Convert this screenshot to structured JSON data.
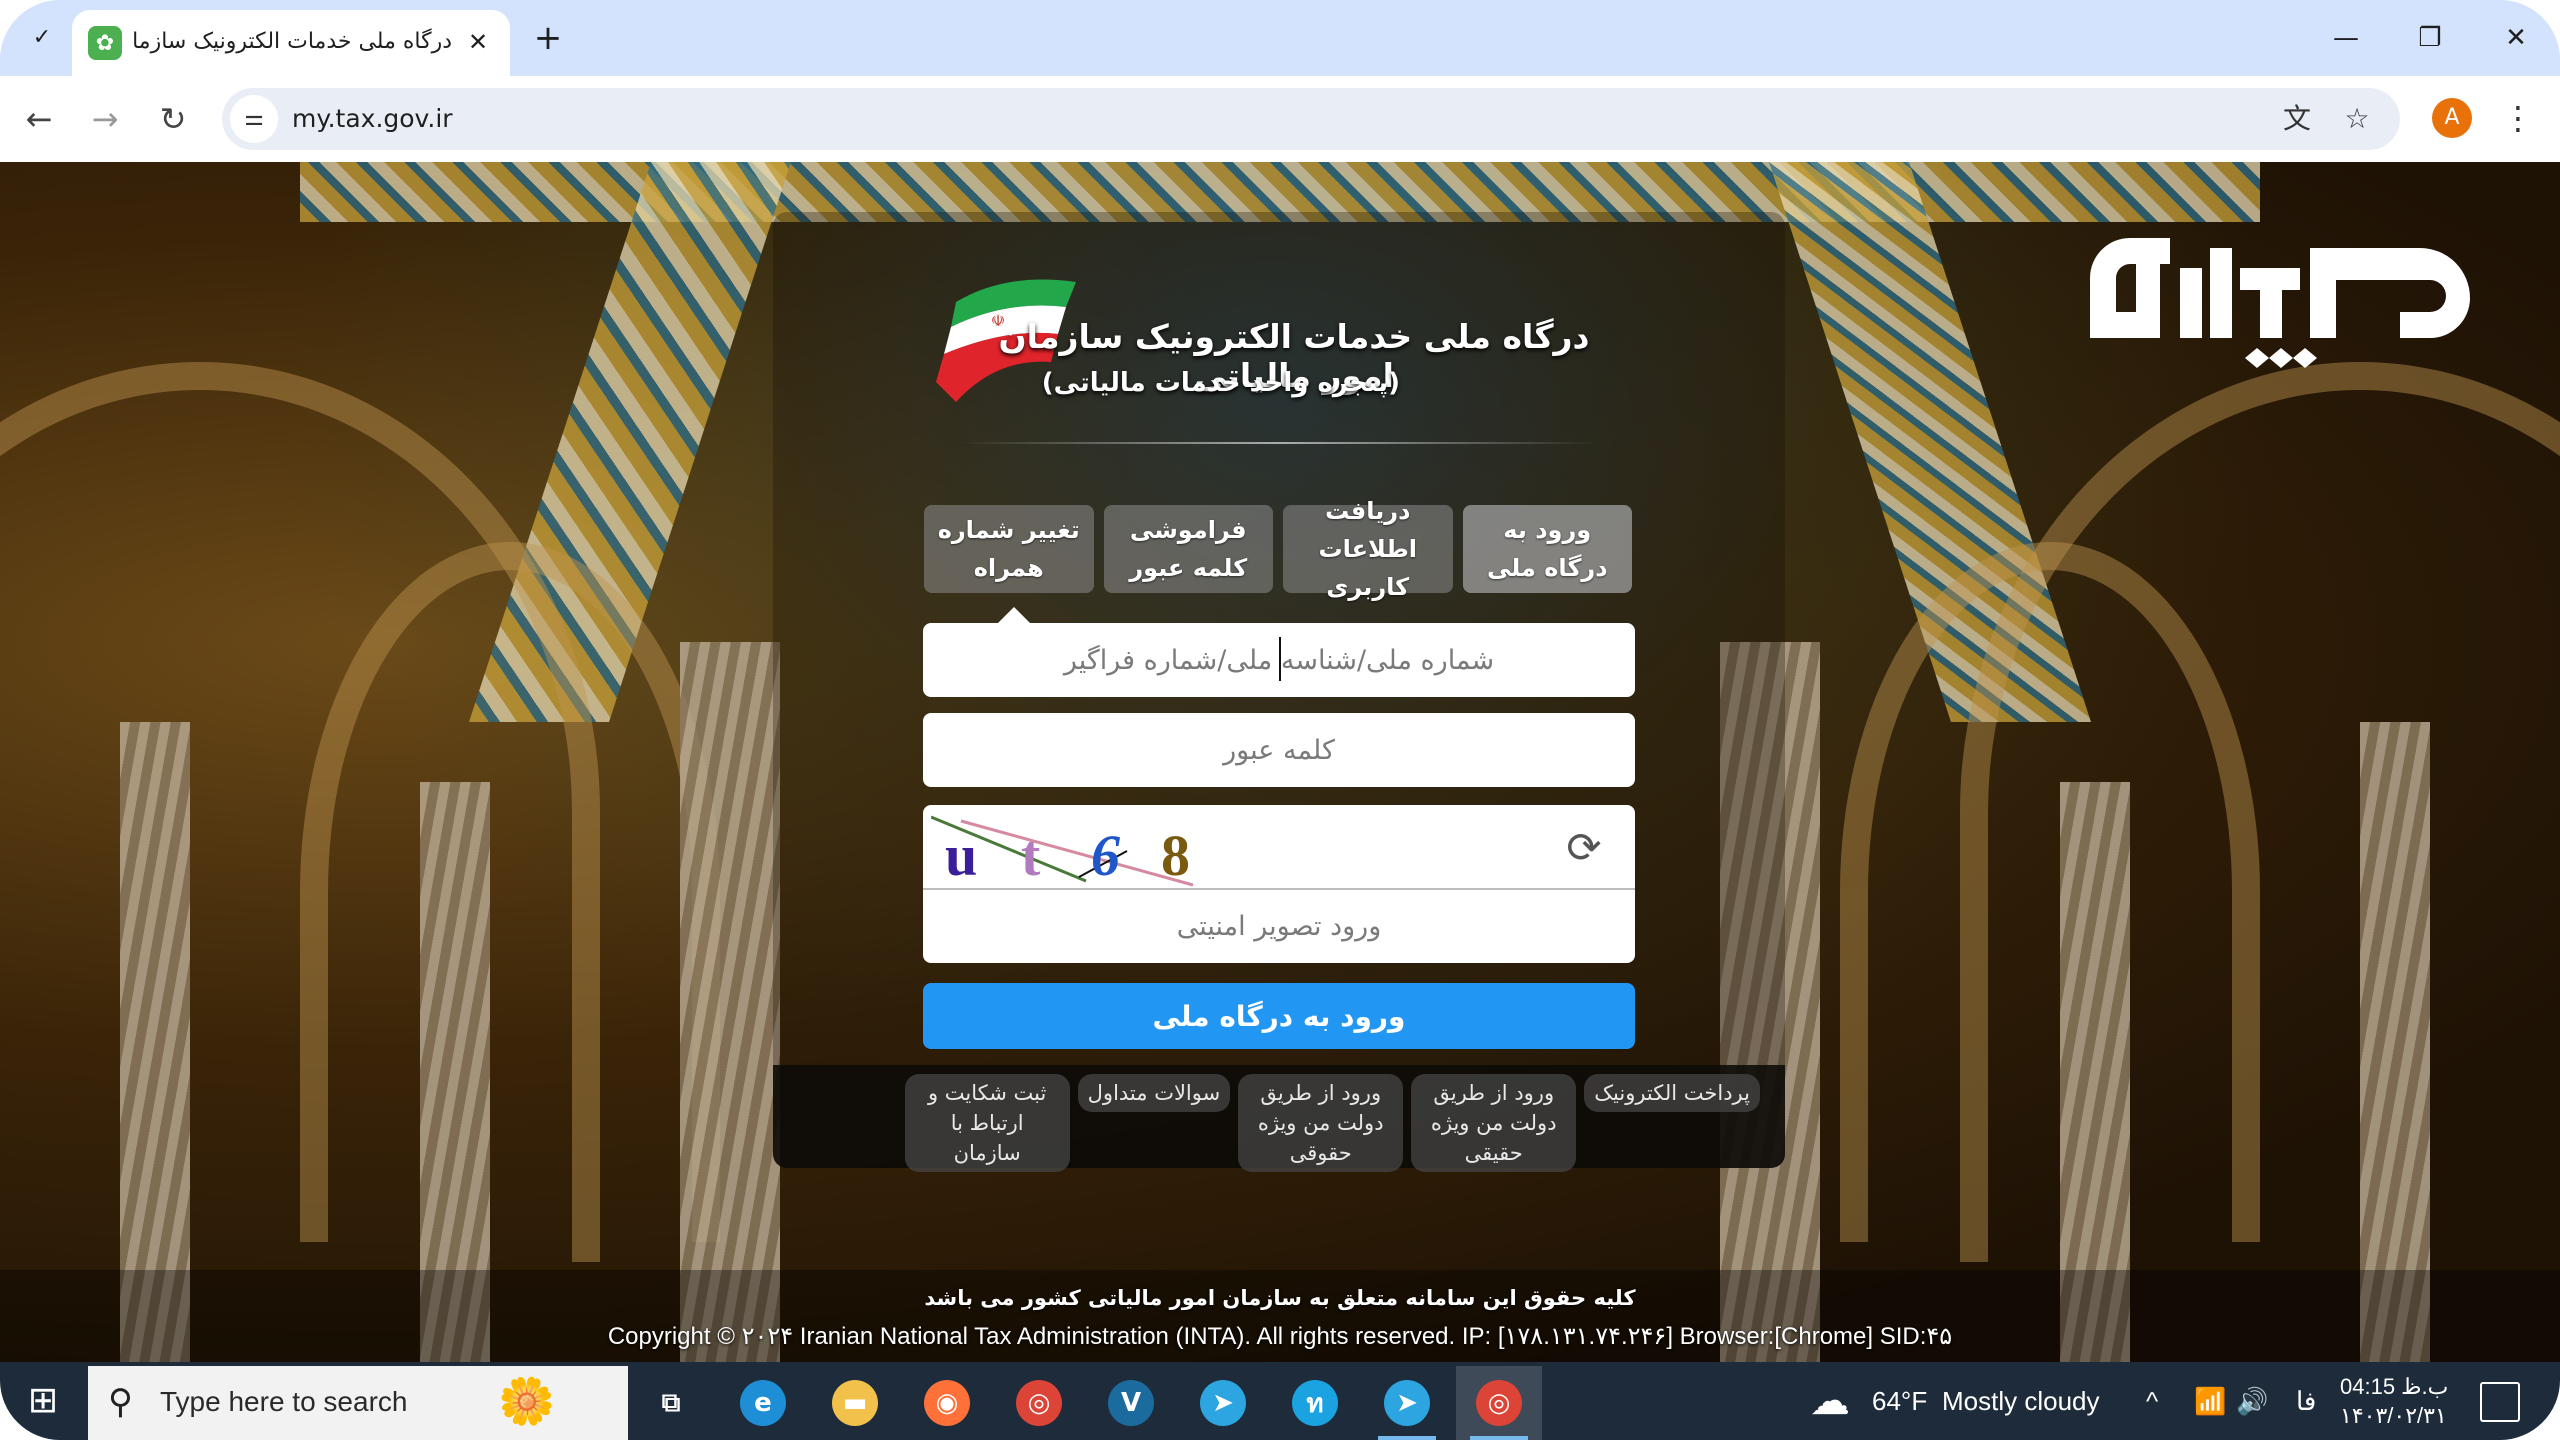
{
  "browser": {
    "tab_search_icon": "✓",
    "tab": {
      "favicon": "tax-portal-gear-icon",
      "title": "درگاه ملی خدمات الکترونیک سازمان امور مالیاتی",
      "close": "✕"
    },
    "new_tab": "+",
    "window_controls": {
      "minimize": "—",
      "restore": "❐",
      "close": "✕"
    },
    "nav": {
      "back": "←",
      "forward": "→",
      "reload": "↻"
    },
    "url": "my.tax.gov.ir",
    "profile_initial": "A",
    "menu": "⋮",
    "translate_icon": "文",
    "bookmark_icon": "☆"
  },
  "portal": {
    "title": "درگاه ملی خدمات الکترونیک سازمان امور مالیاتی",
    "subtitle": "(پنجره واحد خدمات مالیاتی)",
    "logo_text": "میلاد",
    "tabs": [
      {
        "label": "ورود به درگاه ملی",
        "active": true
      },
      {
        "label": "دریافت اطلاعات کاربری",
        "active": false
      },
      {
        "label": "فراموشی کلمه عبور",
        "active": false
      },
      {
        "label": "تغییر شماره همراه",
        "active": false
      }
    ],
    "form": {
      "id_placeholder": "شماره ملی/شناسه ملی/شماره فراگیر",
      "id_value": "",
      "password_placeholder": "کلمه عبور",
      "password_value": "",
      "captcha_chars": [
        "u",
        "t",
        "6",
        "8"
      ],
      "captcha_colors": [
        "#3a1f9a",
        "#b27bbf",
        "#1f56c9",
        "#7a5a10"
      ],
      "captcha_refresh_icon": "⟳",
      "captcha_placeholder": "ورود تصویر امنیتی",
      "captcha_value": "",
      "submit_label": "ورود به درگاه ملی",
      "submit_color": "#2196f3"
    },
    "links": [
      "پرداخت الکترونیک",
      "ورود از طریق دولت من ویژه حقیقی",
      "ورود از طریق دولت من ویژه حقوقی",
      "سوالات متداول",
      "ثبت شکایت و ارتباط با سازمان"
    ],
    "footer": {
      "rights_fa": "کلیه حقوق این سامانه متعلق به سازمان امور مالیاتی کشور می باشد",
      "copyright": "Copyright © ۲۰۲۴ Iranian National Tax Administration (INTA). All rights reserved. IP: [۱۷۸.۱۳۱.۷۴.۲۴۶] Browser:[Chrome] SID:۴۵"
    }
  },
  "taskbar": {
    "start_icon": "⊞",
    "search_placeholder": "Type here to search",
    "apps": [
      {
        "name": "task-view",
        "glyph": "⧉",
        "color": "transparent"
      },
      {
        "name": "edge",
        "glyph": "e",
        "color": "#1e8fd6"
      },
      {
        "name": "file-explorer",
        "glyph": "▬",
        "color": "#f2c14b"
      },
      {
        "name": "firefox",
        "glyph": "◉",
        "color": "#ff7139"
      },
      {
        "name": "chrome",
        "glyph": "◎",
        "color": "#db4437"
      },
      {
        "name": "v-app",
        "glyph": "V",
        "color": "#1b6b9e"
      },
      {
        "name": "telegram",
        "glyph": "➤",
        "color": "#2ca5e0"
      },
      {
        "name": "n-app",
        "glyph": "ท",
        "color": "#1aa3e0"
      },
      {
        "name": "telegram-2",
        "glyph": "➤",
        "color": "#2ca5e0"
      },
      {
        "name": "chrome-profile",
        "glyph": "◎",
        "color": "#db4437"
      }
    ],
    "weather": {
      "temp": "64°F",
      "condition": "Mostly cloudy"
    },
    "tray_chevron": "^",
    "language": "فا",
    "time": "04:15 ب.ظ",
    "date": "۱۴۰۳/۰۲/۳۱"
  }
}
